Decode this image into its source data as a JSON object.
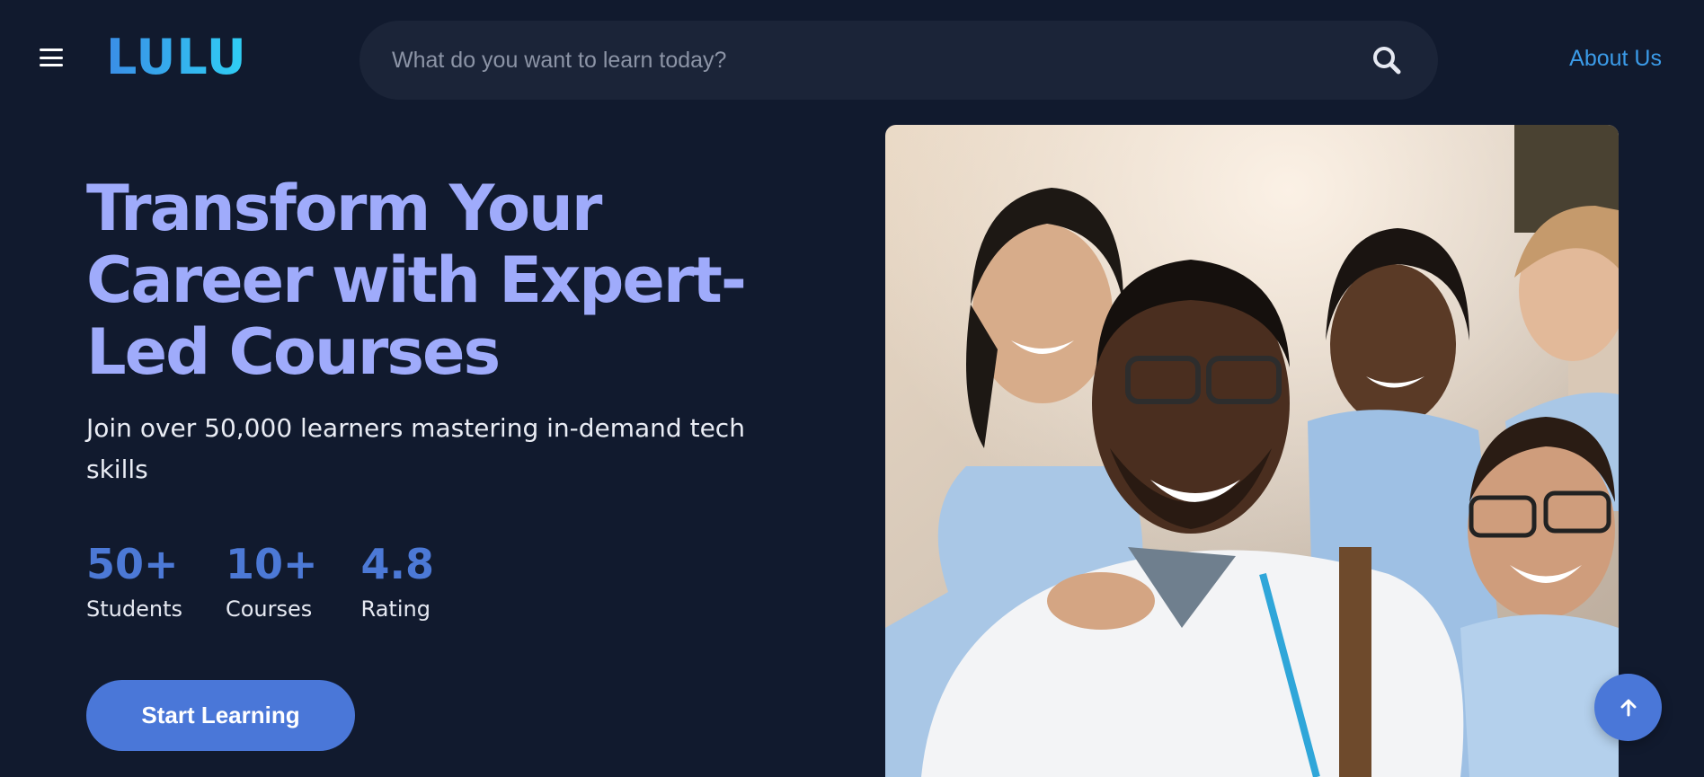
{
  "header": {
    "logo_text": "LULU",
    "search": {
      "placeholder": "What do you want to learn today?",
      "value": ""
    },
    "about_link": "About Us"
  },
  "hero": {
    "title": "Transform Your Career with Expert-Led Courses",
    "subtitle": "Join over 50,000 learners mastering in-demand tech skills",
    "stats": [
      {
        "value": "50+",
        "label": "Students"
      },
      {
        "value": "10+",
        "label": "Courses"
      },
      {
        "value": "4.8",
        "label": "Rating"
      }
    ],
    "cta_label": "Start Learning"
  },
  "colors": {
    "background": "#111a2e",
    "search_bg": "#1b2438",
    "title": "#9fabfb",
    "accent": "#4a77d8",
    "link": "#3b9be8"
  },
  "icons": {
    "menu": "hamburger-icon",
    "search": "search-icon",
    "scroll_top": "arrow-up-icon"
  }
}
